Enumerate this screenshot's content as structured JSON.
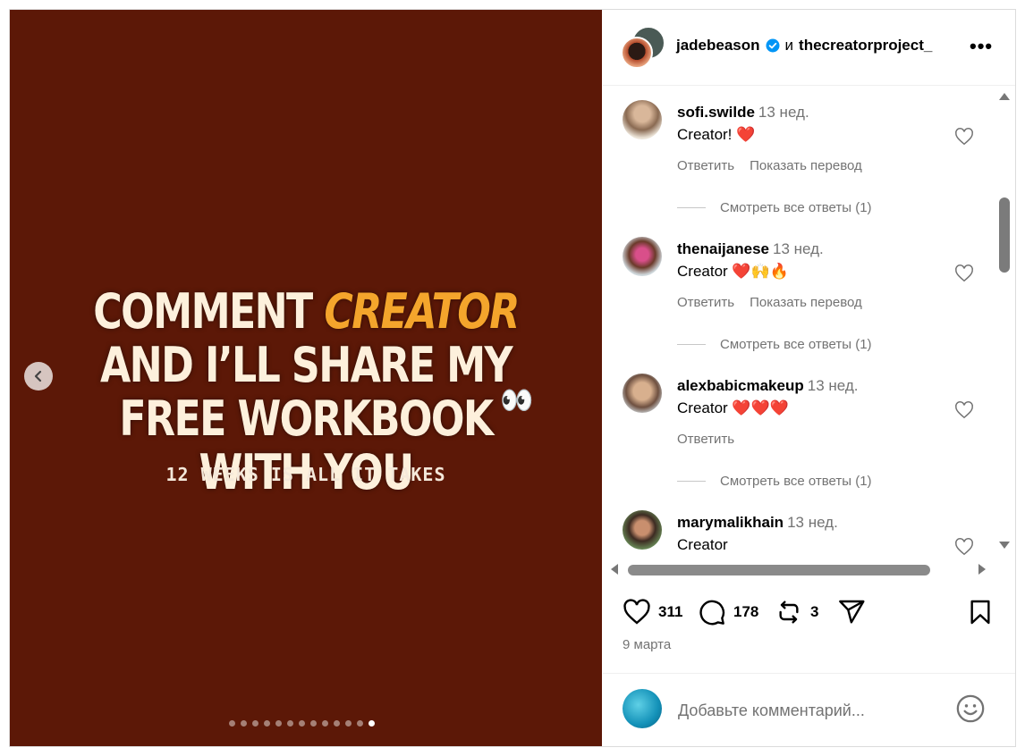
{
  "post": {
    "headline_pre": "COMMENT ",
    "headline_accent": "CREATOR",
    "headline_post": " AND I’LL SHARE MY FREE WORKBOOK WITH YOU",
    "eyes": "👀",
    "subline": "12 WEEKS IS ALL IT TAKES",
    "slide_count": 13,
    "active_slide": 13,
    "background_color": "#5c1807",
    "accent_color": "#f4a52c"
  },
  "header": {
    "author": "jadebeason",
    "conjunction": "и",
    "coauthor": "thecreatorproject_",
    "more_label": "•••",
    "verified_color": "#0095f6"
  },
  "comments": [
    {
      "user": "sofi.swilde",
      "time": "13 нед.",
      "text": "Creator! ❤️",
      "reply": "Ответить",
      "translate": "Показать перевод",
      "view_replies": "Смотреть все ответы (1)"
    },
    {
      "user": "thenaijanese",
      "time": "13 нед.",
      "text": "Creator ❤️🙌🔥",
      "reply": "Ответить",
      "translate": "Показать перевод",
      "view_replies": "Смотреть все ответы (1)"
    },
    {
      "user": "alexbabicmakeup",
      "time": "13 нед.",
      "text": "Creator ❤️❤️❤️",
      "reply": "Ответить",
      "view_replies": "Смотреть все ответы (1)"
    },
    {
      "user": "marymalikhain",
      "time": "13 нед.",
      "text": "Creator"
    }
  ],
  "actions": {
    "likes": "311",
    "comments": "178",
    "reposts": "3",
    "date": "9 марта"
  },
  "add_comment": {
    "placeholder": "Добавьте комментарий..."
  }
}
